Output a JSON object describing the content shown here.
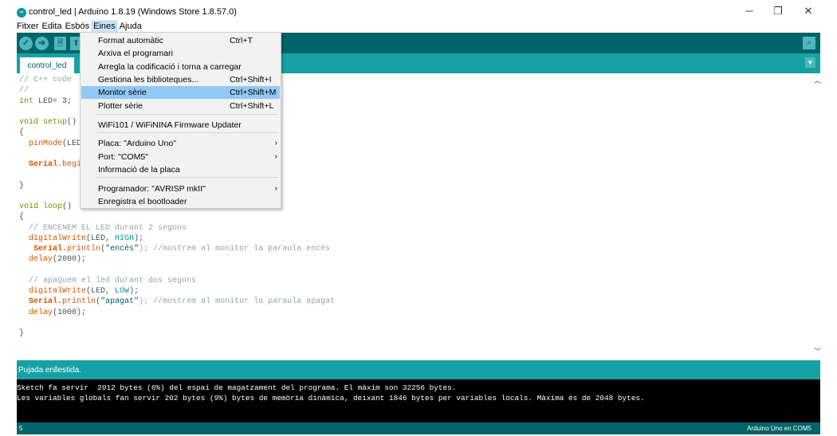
{
  "window": {
    "title": "control_led | Arduino 1.8.19 (Windows Store 1.8.57.0)",
    "app_icon": "∞",
    "minimize": "─",
    "restore": "❐",
    "close": "✕"
  },
  "menubar": [
    "Fitxer",
    "Edita",
    "Esbós",
    "Eines",
    "Ajuda"
  ],
  "toolbar": {
    "verify": "✓",
    "upload": "➜",
    "new": "🗎",
    "open": "⬆",
    "serial": "⌕"
  },
  "tab": {
    "label": "control_led",
    "menu_icon": "▼"
  },
  "code": [
    {
      "line": 0,
      "seg": [
        [
          "// C++ code",
          "cm"
        ]
      ]
    },
    {
      "line": 1,
      "seg": [
        [
          "//",
          "cm"
        ]
      ]
    },
    {
      "line": 2,
      "seg": [
        [
          "int",
          "kw"
        ],
        [
          " LED= 3;",
          ""
        ]
      ]
    },
    {
      "line": 4,
      "seg": [
        [
          "void",
          "kw"
        ],
        [
          " ",
          ""
        ],
        [
          "setup",
          "kw"
        ],
        [
          "()",
          ""
        ]
      ]
    },
    {
      "line": 5,
      "seg": [
        [
          "{",
          ""
        ]
      ]
    },
    {
      "line": 6,
      "seg": [
        [
          "  ",
          ""
        ],
        [
          "pinMode",
          "fn"
        ],
        [
          "(LED",
          ""
        ]
      ]
    },
    {
      "line": 8,
      "seg": [
        [
          "  ",
          ""
        ],
        [
          "Serial",
          "ob"
        ],
        [
          ".begi",
          "fn"
        ]
      ]
    },
    {
      "line": 10,
      "seg": [
        [
          "}",
          ""
        ]
      ]
    },
    {
      "line": 12,
      "seg": [
        [
          "void",
          "kw"
        ],
        [
          " ",
          ""
        ],
        [
          "loop",
          "kw"
        ],
        [
          "()",
          ""
        ]
      ]
    },
    {
      "line": 13,
      "seg": [
        [
          "{",
          ""
        ]
      ]
    },
    {
      "line": 14,
      "seg": [
        [
          "  // ENCENEM EL LED durant 2 segons",
          "cm"
        ]
      ]
    },
    {
      "line": 15,
      "seg": [
        [
          "  ",
          ""
        ],
        [
          "digitalWrite",
          "fn"
        ],
        [
          "(LED, ",
          ""
        ],
        [
          "HIGH",
          "cn"
        ],
        [
          ");",
          ""
        ]
      ]
    },
    {
      "line": 16,
      "seg": [
        [
          "   ",
          ""
        ],
        [
          "Serial",
          "ob"
        ],
        [
          ".",
          ""
        ],
        [
          "println",
          "fn"
        ],
        [
          "(",
          ""
        ],
        [
          "\"encès\"",
          "str"
        ],
        [
          "); //mostrem al monitor la paraula encès",
          "cm"
        ]
      ]
    },
    {
      "line": 17,
      "seg": [
        [
          "  ",
          ""
        ],
        [
          "delay",
          "fn"
        ],
        [
          "(2000);",
          ""
        ]
      ]
    },
    {
      "line": 19,
      "seg": [
        [
          "  // apaguem el led durant dos segons",
          "cm"
        ]
      ]
    },
    {
      "line": 20,
      "seg": [
        [
          "  ",
          ""
        ],
        [
          "digitalWrite",
          "fn"
        ],
        [
          "(LED, ",
          ""
        ],
        [
          "LOW",
          "cn"
        ],
        [
          ");",
          ""
        ]
      ]
    },
    {
      "line": 21,
      "seg": [
        [
          "  ",
          ""
        ],
        [
          "Serial",
          "ob"
        ],
        [
          ".",
          ""
        ],
        [
          "println",
          "fn"
        ],
        [
          "(",
          ""
        ],
        [
          "\"apagat\"",
          "str"
        ],
        [
          "); //mostrem al monitor la paraula apagat",
          "cm"
        ]
      ]
    },
    {
      "line": 22,
      "seg": [
        [
          "  ",
          ""
        ],
        [
          "delay",
          "fn"
        ],
        [
          "(1000);",
          ""
        ]
      ]
    },
    {
      "line": 24,
      "seg": [
        [
          "}",
          ""
        ]
      ]
    }
  ],
  "eines_menu": [
    {
      "label": "Format automàtic",
      "shortcut": "Ctrl+T"
    },
    {
      "label": "Arxiva el programari",
      "shortcut": ""
    },
    {
      "label": "Arregla la codificació i torna a carregar",
      "shortcut": ""
    },
    {
      "label": "Gestiona les biblioteques...",
      "shortcut": "Ctrl+Shift+I"
    },
    {
      "label": "Monitor sèrie",
      "shortcut": "Ctrl+Shift+M",
      "selected": true
    },
    {
      "label": "Plotter sèrie",
      "shortcut": "Ctrl+Shift+L"
    },
    {
      "label": "WiFi101 / WiFiNINA Firmware Updater",
      "shortcut": ""
    },
    {
      "label": "Placa: \"Arduino Uno\"",
      "shortcut": "",
      "submenu": "›"
    },
    {
      "label": "Port: \"COM5\"",
      "shortcut": "",
      "submenu": "›"
    },
    {
      "label": "Informació de la placa",
      "shortcut": ""
    },
    {
      "label": "Programador: \"AVRISP mkII\"",
      "shortcut": "",
      "submenu": "›"
    },
    {
      "label": "Enregistra el bootloader",
      "shortcut": ""
    }
  ],
  "status": {
    "message": "Pujada enllestida."
  },
  "console": [
    "Sketch fa servir  2012 bytes (6%) del espai de magatzament del programa. El màxim son 32256 bytes.",
    "Les variables globals fan servir 202 bytes (9%) bytes de memòria dinàmica, deixant 1846 bytes per variables locals. Màxima és de 2048 bytes."
  ],
  "footer": {
    "line": "5",
    "board": "Arduino Uno en COM5"
  },
  "scroll": {
    "up": "︿",
    "down": "﹀"
  }
}
